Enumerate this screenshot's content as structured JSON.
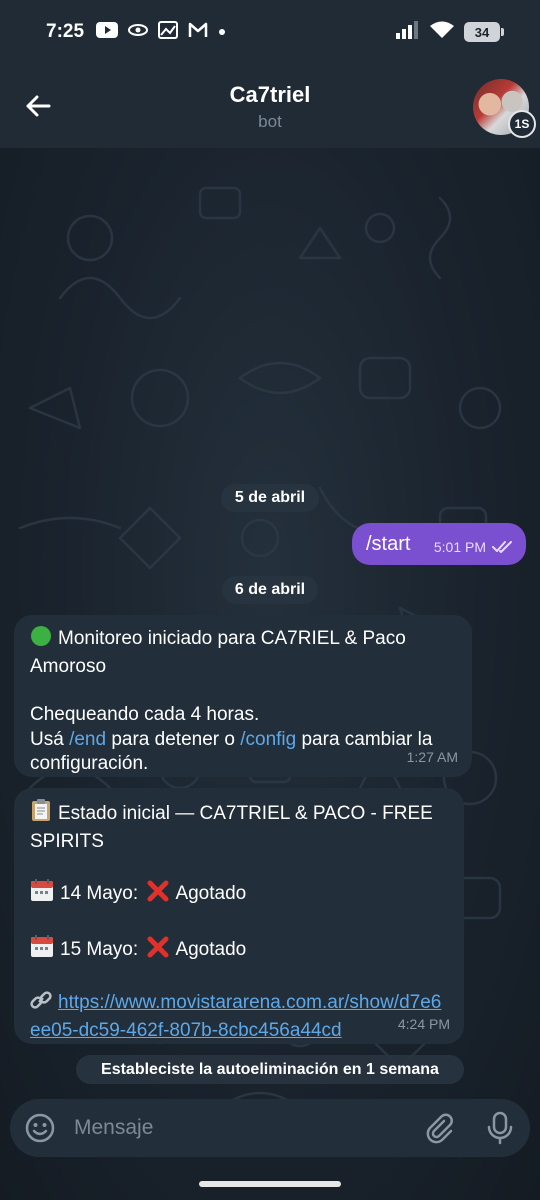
{
  "status_bar": {
    "time": "7:25",
    "battery": "34"
  },
  "header": {
    "title": "Ca7triel",
    "subtitle": "bot",
    "timer_badge": "1S"
  },
  "messages": {
    "date1": "5 de abril",
    "start": {
      "text": "/start",
      "time": "5:01 PM"
    },
    "date2": "6 de abril",
    "monitor": {
      "line1": "Monitoreo iniciado para CA7RIEL & Paco Amoroso",
      "line2": "Chequeando cada 4 horas.",
      "usa": "Usá",
      "end_cmd": "/end",
      "mid": "para detener o",
      "config_cmd": "/config",
      "tail": "para cambiar la configuración.",
      "time": "1:27 AM"
    },
    "status": {
      "title": "Estado inicial — CA7TRIEL & PACO - FREE SPIRITS",
      "date1_label": "14 Mayo:",
      "date1_status": "Agotado",
      "date2_label": "15 Mayo:",
      "date2_status": "Agotado",
      "url": "https://www.movistararena.com.ar/show/d7e6ee05-dc59-462f-807b-8cbc456a44cd",
      "time": "4:24 PM"
    },
    "notice": "Estableciste la autoeliminación en 1 semana"
  },
  "input": {
    "placeholder": "Mensaje"
  },
  "icons": {
    "back": "arrow-left-icon",
    "emoji": "smiley-icon",
    "attach": "paperclip-icon",
    "mic": "microphone-icon",
    "read": "double-check-icon"
  },
  "colors": {
    "outgoing_bubble": "#7a4fd0",
    "incoming_bubble": "#222e3a",
    "link": "#5fa8e8",
    "header": "#202b36"
  }
}
